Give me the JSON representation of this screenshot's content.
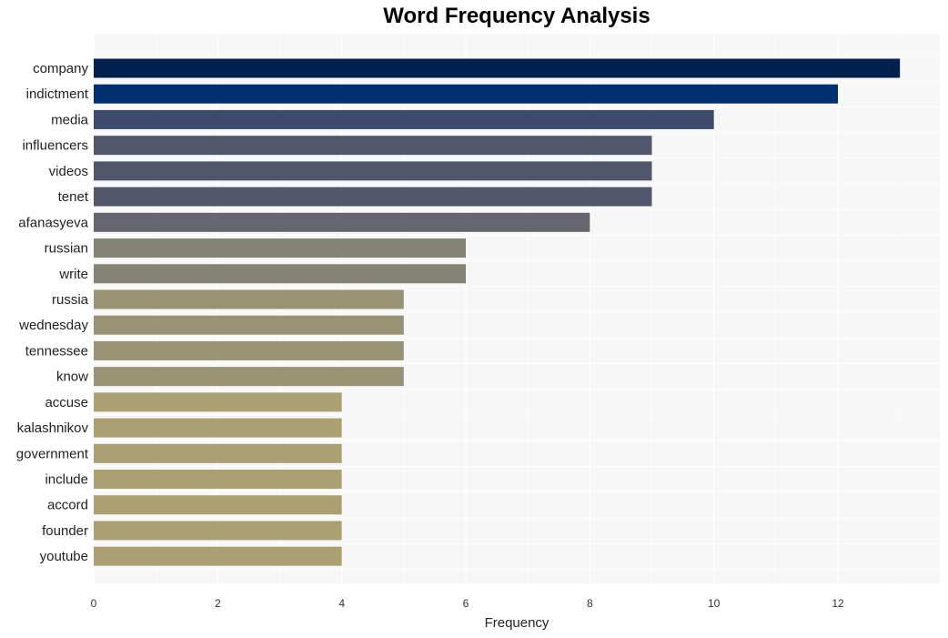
{
  "chart_data": {
    "type": "bar",
    "orientation": "horizontal",
    "title": "Word Frequency Analysis",
    "xlabel": "Frequency",
    "ylabel": "",
    "xlim": [
      0,
      13.65
    ],
    "xticks": [
      0,
      2,
      4,
      6,
      8,
      10,
      12
    ],
    "grid": true,
    "legend": "none",
    "categories": [
      "company",
      "indictment",
      "media",
      "influencers",
      "videos",
      "tenet",
      "afanasyeva",
      "russian",
      "write",
      "russia",
      "wednesday",
      "tennessee",
      "know",
      "accuse",
      "kalashnikov",
      "government",
      "include",
      "accord",
      "founder",
      "youtube"
    ],
    "values": [
      13,
      12,
      10,
      9,
      9,
      9,
      8,
      6,
      6,
      5,
      5,
      5,
      5,
      4,
      4,
      4,
      4,
      4,
      4,
      4
    ],
    "colors": [
      "#00204e",
      "#00306f",
      "#3e4a6b",
      "#52566b",
      "#52566b",
      "#52566b",
      "#65666f",
      "#858276",
      "#858276",
      "#999375",
      "#999375",
      "#999375",
      "#999375",
      "#aba072",
      "#aba072",
      "#aba072",
      "#aba072",
      "#aba072",
      "#aba072",
      "#aba072"
    ]
  }
}
